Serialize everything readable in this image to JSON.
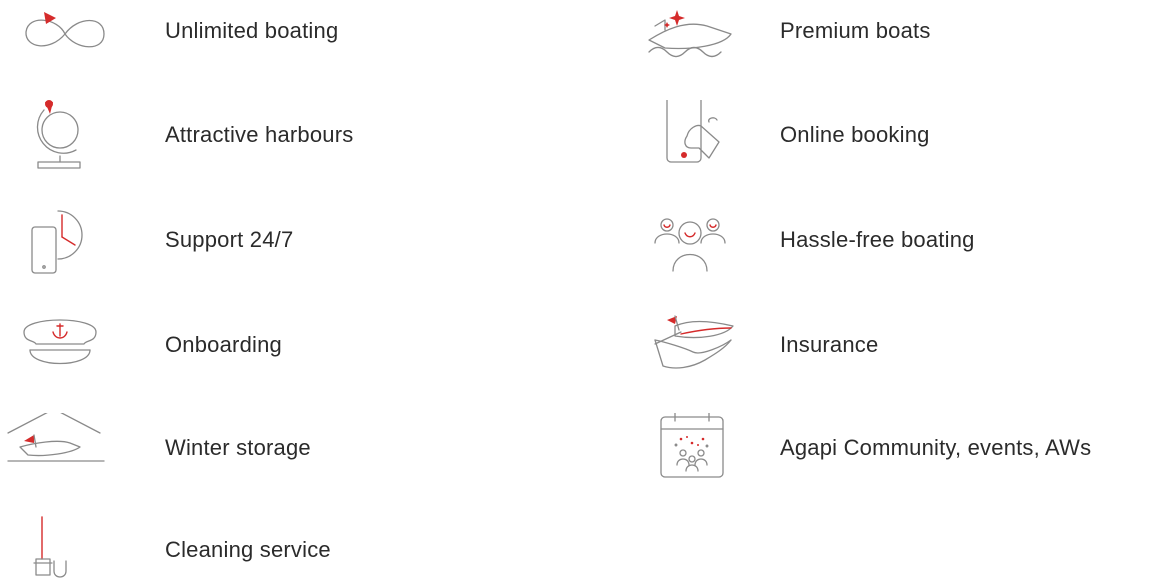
{
  "features": {
    "left": [
      {
        "label": "Unlimited boating",
        "icon": "infinity-icon"
      },
      {
        "label": "Attractive harbours",
        "icon": "globe-icon"
      },
      {
        "label": "Support 24/7",
        "icon": "phone-clock-icon"
      },
      {
        "label": "Onboarding",
        "icon": "captain-hat-icon"
      },
      {
        "label": "Winter storage",
        "icon": "boat-shed-icon"
      },
      {
        "label": "Cleaning service",
        "icon": "mop-bucket-icon"
      }
    ],
    "right": [
      {
        "label": "Premium boats",
        "icon": "sparkling-boat-icon"
      },
      {
        "label": "Online booking",
        "icon": "phone-tap-icon"
      },
      {
        "label": "Hassle-free boating",
        "icon": "happy-people-icon"
      },
      {
        "label": "Insurance",
        "icon": "hand-boat-icon"
      },
      {
        "label": "Agapi Community, events, AWs",
        "icon": "calendar-people-icon"
      }
    ]
  },
  "colors": {
    "accent": "#d52b2b",
    "icon_stroke": "#8a8a8a",
    "text": "#2b2b2b"
  }
}
